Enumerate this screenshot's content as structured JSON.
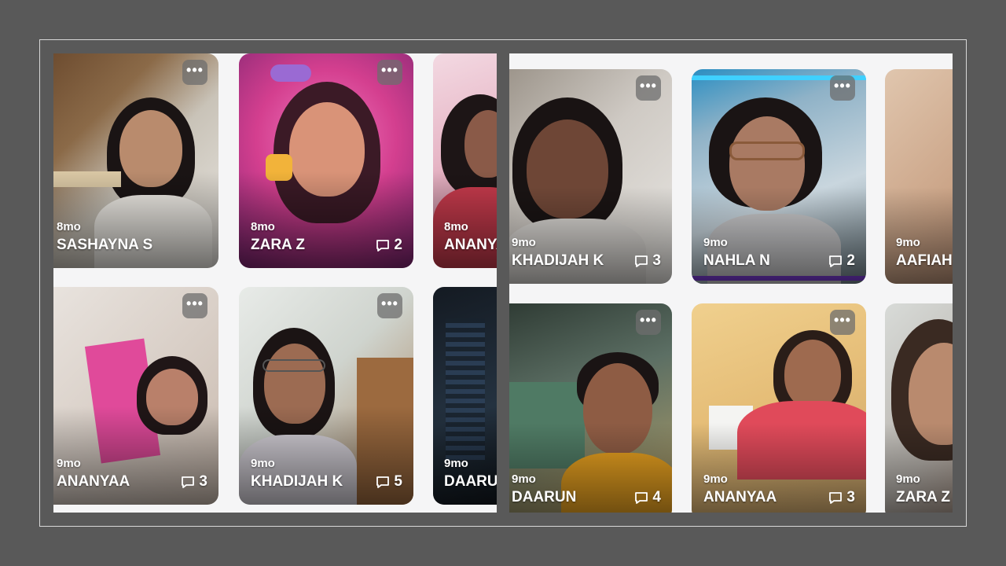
{
  "menu_glyph": "•••",
  "icons": {
    "more": "more-options-icon",
    "comment": "comment-bubble-icon"
  },
  "left_grid": [
    {
      "age": "8mo",
      "name": "SASHAYNA S",
      "comments": ""
    },
    {
      "age": "8mo",
      "name": "ZARA Z",
      "comments": "2"
    },
    {
      "age": "8mo",
      "name": "ANANYAA",
      "comments": ""
    },
    {
      "age": "9mo",
      "name": "ANANYAA",
      "comments": "3"
    },
    {
      "age": "9mo",
      "name": "KHADIJAH K",
      "comments": "5"
    },
    {
      "age": "9mo",
      "name": "DAARUN",
      "comments": ""
    }
  ],
  "right_grid": [
    {
      "age": "9mo",
      "name": "KHADIJAH K",
      "comments": "3"
    },
    {
      "age": "9mo",
      "name": "NAHLA N",
      "comments": "2"
    },
    {
      "age": "9mo",
      "name": "AAFIAH",
      "comments": ""
    },
    {
      "age": "9mo",
      "name": "DAARUN",
      "comments": "4"
    },
    {
      "age": "9mo",
      "name": "ANANYAA",
      "comments": "3"
    },
    {
      "age": "9mo",
      "name": "ZARA Z",
      "comments": ""
    }
  ]
}
